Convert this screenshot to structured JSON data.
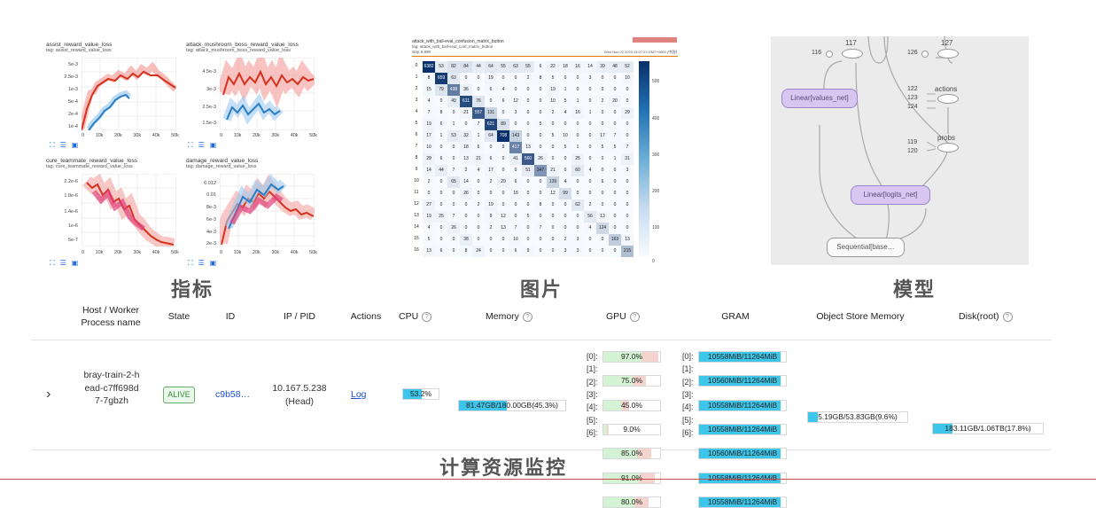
{
  "metrics_panels": [
    {
      "title": "assist_reward_value_loss",
      "tag": "tag: assist_reward_value_loss",
      "yticks": [
        "5e-3",
        "2.5e-3",
        "1e-3",
        "5e-4",
        "2e-4",
        "1e-4"
      ],
      "xticks": [
        "0",
        "10k",
        "20k",
        "30k",
        "40k",
        "50k"
      ]
    },
    {
      "title": "attack_mushroom_boss_reward_value_loss",
      "tag": "tag: attack_mushroom_boss_reward_value_loss",
      "yticks": [
        "4.5e-3",
        "3e-3",
        "2.5e-3",
        "1.5e-3"
      ],
      "xticks": [
        "0",
        "10k",
        "20k",
        "30k",
        "40k",
        "50k"
      ]
    },
    {
      "title": "cure_teammate_reward_value_loss",
      "tag": "tag: cure_teammate_reward_value_loss",
      "yticks": [
        "2.2e-6",
        "1.8e-6",
        "1.4e-6",
        "1e-6",
        "5e-7"
      ],
      "xticks": [
        "0",
        "10k",
        "20k",
        "30k",
        "40k",
        "50k"
      ]
    },
    {
      "title": "damage_reward_value_loss",
      "tag": "tag: damage_reward_value_loss",
      "yticks": [
        "0.012",
        "0.01",
        "8e-3",
        "6e-3",
        "4e-3",
        "2e-3"
      ],
      "xticks": [
        "0",
        "10k",
        "20k",
        "30k",
        "40k",
        "50k"
      ]
    }
  ],
  "section_labels": {
    "metrics": "指标",
    "images": "图片",
    "model": "模型",
    "compute": "计算资源监控"
  },
  "confusion": {
    "title": "attack_with_ball-eval_confusion_matrix_button",
    "subtitle": "tag: attack_with_ball-eval_conf_matrix_button",
    "step": "step 9,999",
    "timestamp": "Wed Nov 22 2023 15:07:23 GMT+0800 (中国标准时间)",
    "row_labels": [
      "0",
      "1",
      "2",
      "3",
      "4",
      "5",
      "6",
      "7",
      "8",
      "9",
      "10",
      "11",
      "12",
      "13",
      "14",
      "15",
      "16"
    ],
    "colorbar_ticks": [
      "500",
      "400",
      "300",
      "200",
      "100",
      "0"
    ],
    "rows": [
      [
        "6382",
        "53",
        "82",
        "84",
        "44",
        "64",
        "55",
        "63",
        "55",
        "6",
        "22",
        "18",
        "16",
        "14",
        "39",
        "48",
        "52"
      ],
      [
        "8",
        "659",
        "63",
        "0",
        "0",
        "19",
        "0",
        "0",
        "2",
        "8",
        "5",
        "0",
        "0",
        "3",
        "0",
        "0",
        "10"
      ],
      [
        "15",
        "79",
        "438",
        "36",
        "0",
        "6",
        "4",
        "0",
        "0",
        "0",
        "19",
        "1",
        "0",
        "0",
        "0",
        "0",
        "0"
      ],
      [
        "4",
        "0",
        "49",
        "611",
        "76",
        "0",
        "6",
        "12",
        "0",
        "0",
        "10",
        "5",
        "1",
        "0",
        "2",
        "20",
        "0"
      ],
      [
        "7",
        "8",
        "0",
        "21",
        "557",
        "131",
        "0",
        "3",
        "0",
        "0",
        "2",
        "4",
        "16",
        "1",
        "0",
        "0",
        "29"
      ],
      [
        "19",
        "6",
        "1",
        "0",
        "7",
        "621",
        "89",
        "0",
        "0",
        "5",
        "0",
        "0",
        "0",
        "0",
        "0",
        "0",
        "0"
      ],
      [
        "17",
        "1",
        "53",
        "32",
        "1",
        "64",
        "708",
        "143",
        "0",
        "0",
        "5",
        "10",
        "0",
        "0",
        "17",
        "7",
        "0"
      ],
      [
        "10",
        "0",
        "0",
        "18",
        "6",
        "0",
        "9",
        "417",
        "13",
        "0",
        "0",
        "5",
        "1",
        "0",
        "5",
        "5",
        "7"
      ],
      [
        "29",
        "6",
        "0",
        "13",
        "21",
        "6",
        "0",
        "41",
        "560",
        "26",
        "0",
        "0",
        "25",
        "0",
        "0",
        "1",
        "31"
      ],
      [
        "14",
        "44",
        "7",
        "2",
        "4",
        "17",
        "0",
        "0",
        "51",
        "347",
        "21",
        "0",
        "60",
        "4",
        "0",
        "0",
        "3"
      ],
      [
        "2",
        "0",
        "65",
        "14",
        "0",
        "2",
        "29",
        "6",
        "0",
        "0",
        "139",
        "4",
        "0",
        "0",
        "6",
        "0",
        "0"
      ],
      [
        "0",
        "0",
        "0",
        "26",
        "0",
        "0",
        "0",
        "16",
        "0",
        "0",
        "12",
        "99",
        "0",
        "0",
        "0",
        "0",
        "0"
      ],
      [
        "27",
        "0",
        "0",
        "0",
        "2",
        "19",
        "0",
        "0",
        "0",
        "8",
        "0",
        "0",
        "62",
        "2",
        "0",
        "0",
        "0"
      ],
      [
        "19",
        "25",
        "7",
        "0",
        "0",
        "9",
        "12",
        "0",
        "5",
        "0",
        "0",
        "0",
        "0",
        "56",
        "13",
        "0",
        "0"
      ],
      [
        "4",
        "0",
        "26",
        "0",
        "0",
        "2",
        "13",
        "7",
        "0",
        "7",
        "0",
        "0",
        "0",
        "4",
        "124",
        "0",
        "0"
      ],
      [
        "5",
        "0",
        "0",
        "38",
        "0",
        "0",
        "0",
        "10",
        "0",
        "0",
        "0",
        "2",
        "3",
        "0",
        "0",
        "163",
        "13"
      ],
      [
        "13",
        "6",
        "0",
        "8",
        "24",
        "0",
        "0",
        "6",
        "9",
        "0",
        "0",
        "3",
        "3",
        "0",
        "0",
        "0",
        "215"
      ]
    ]
  },
  "graph": {
    "nodes": {
      "n117": "117",
      "n127": "127",
      "n116": "116",
      "n126": "126",
      "n122": "122",
      "n123": "123",
      "n124": "124",
      "n119": "119",
      "n120": "120"
    },
    "actions": "actions",
    "probs": "probs",
    "linear_values": "Linear[values_net]",
    "linear_logits": "Linear[logits_net]",
    "sequential": "Sequential[base…"
  },
  "table": {
    "headers": {
      "host": "Host / Worker Process name",
      "state": "State",
      "id": "ID",
      "ip_pid": "IP / PID",
      "actions": "Actions",
      "cpu": "CPU",
      "memory": "Memory",
      "gpu": "GPU",
      "gram": "GRAM",
      "object_store": "Object Store Memory",
      "disk": "Disk(root)"
    },
    "row": {
      "expand": "›",
      "host": "bray-train-2-head-c7ff698d7-7gbzh",
      "state": "ALIVE",
      "id": "c9b58…",
      "ip": "10.167.5.238",
      "pid": "(Head)",
      "action_link": "Log",
      "cpu_text": "53.2%",
      "cpu_fraction": 0.532,
      "memory_text": "81.47GB/180.00GB(45.3%)",
      "memory_fraction": 0.453,
      "gpus": [
        {
          "idx": "[0]:",
          "text": "97.0%",
          "fraction": 0.97
        },
        {
          "idx": "[1]:",
          "text": "75.0%",
          "fraction": 0.75
        },
        {
          "idx": "[2]:",
          "text": "45.0%",
          "fraction": 0.45
        },
        {
          "idx": "[3]:",
          "text": "9.0%",
          "fraction": 0.09
        },
        {
          "idx": "[4]:",
          "text": "85.0%",
          "fraction": 0.85
        },
        {
          "idx": "[5]:",
          "text": "91.0%",
          "fraction": 0.91
        },
        {
          "idx": "[6]:",
          "text": "80.0%",
          "fraction": 0.8
        }
      ],
      "grams": [
        {
          "idx": "[0]:",
          "text": "10558MiB/11264MiB",
          "fraction": 0.937
        },
        {
          "idx": "[1]:",
          "text": "10560MiB/11264MiB",
          "fraction": 0.937
        },
        {
          "idx": "[2]:",
          "text": "10558MiB/11264MiB",
          "fraction": 0.937
        },
        {
          "idx": "[3]:",
          "text": "10558MiB/11264MiB",
          "fraction": 0.937
        },
        {
          "idx": "[4]:",
          "text": "10560MiB/11264MiB",
          "fraction": 0.937
        },
        {
          "idx": "[5]:",
          "text": "10558MiB/11264MiB",
          "fraction": 0.937
        },
        {
          "idx": "[6]:",
          "text": "10558MiB/11264MiB",
          "fraction": 0.937
        }
      ],
      "object_store_text": "5.19GB/53.83GB(9.6%)",
      "object_store_fraction": 0.096,
      "disk_text": "183.11GB/1.06TB(17.8%)",
      "disk_fraction": 0.178
    }
  },
  "colors": {
    "cpu_bar": "#3ec6ea",
    "gram_bar": "#3ec6ea",
    "gpu_green": "#d4f2d4",
    "gpu_red": "#f5d4d0",
    "alive_border": "#6ab06a",
    "link": "#1a4fd1",
    "cm_dark": "#08306b"
  }
}
